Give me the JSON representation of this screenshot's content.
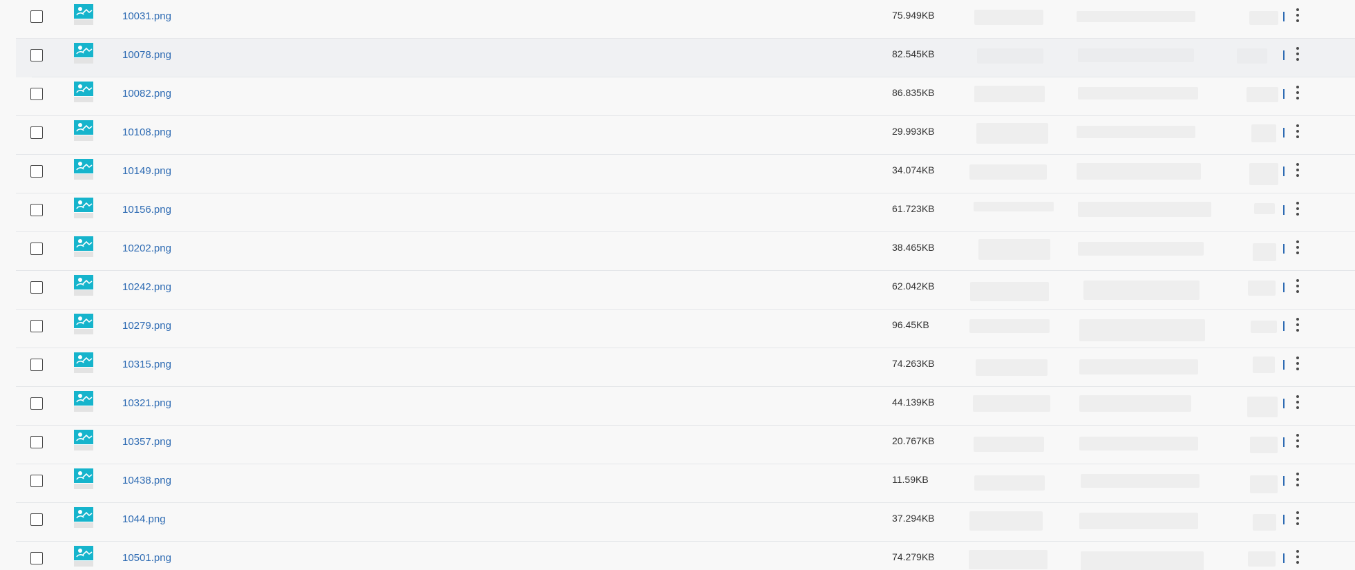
{
  "colors": {
    "link": "#2e6bb3",
    "thumb_accent": "#16b4cc",
    "divider": "#e4e6e9",
    "hover_row": "#f0f1f3"
  },
  "files": [
    {
      "name": "10031.png",
      "size": "75.949KB"
    },
    {
      "name": "10078.png",
      "size": "82.545KB",
      "hovered": true
    },
    {
      "name": "10082.png",
      "size": "86.835KB"
    },
    {
      "name": "10108.png",
      "size": "29.993KB"
    },
    {
      "name": "10149.png",
      "size": "34.074KB"
    },
    {
      "name": "10156.png",
      "size": "61.723KB"
    },
    {
      "name": "10202.png",
      "size": "38.465KB"
    },
    {
      "name": "10242.png",
      "size": "62.042KB"
    },
    {
      "name": "10279.png",
      "size": "96.45KB"
    },
    {
      "name": "10315.png",
      "size": "74.263KB"
    },
    {
      "name": "10321.png",
      "size": "44.139KB"
    },
    {
      "name": "10357.png",
      "size": "20.767KB"
    },
    {
      "name": "10438.png",
      "size": "11.59KB"
    },
    {
      "name": "1044.png",
      "size": "37.294KB"
    },
    {
      "name": "10501.png",
      "size": "74.279KB"
    }
  ],
  "icons": {
    "thumbnail": "image-file-icon",
    "row_menu": "more-vertical-icon"
  }
}
